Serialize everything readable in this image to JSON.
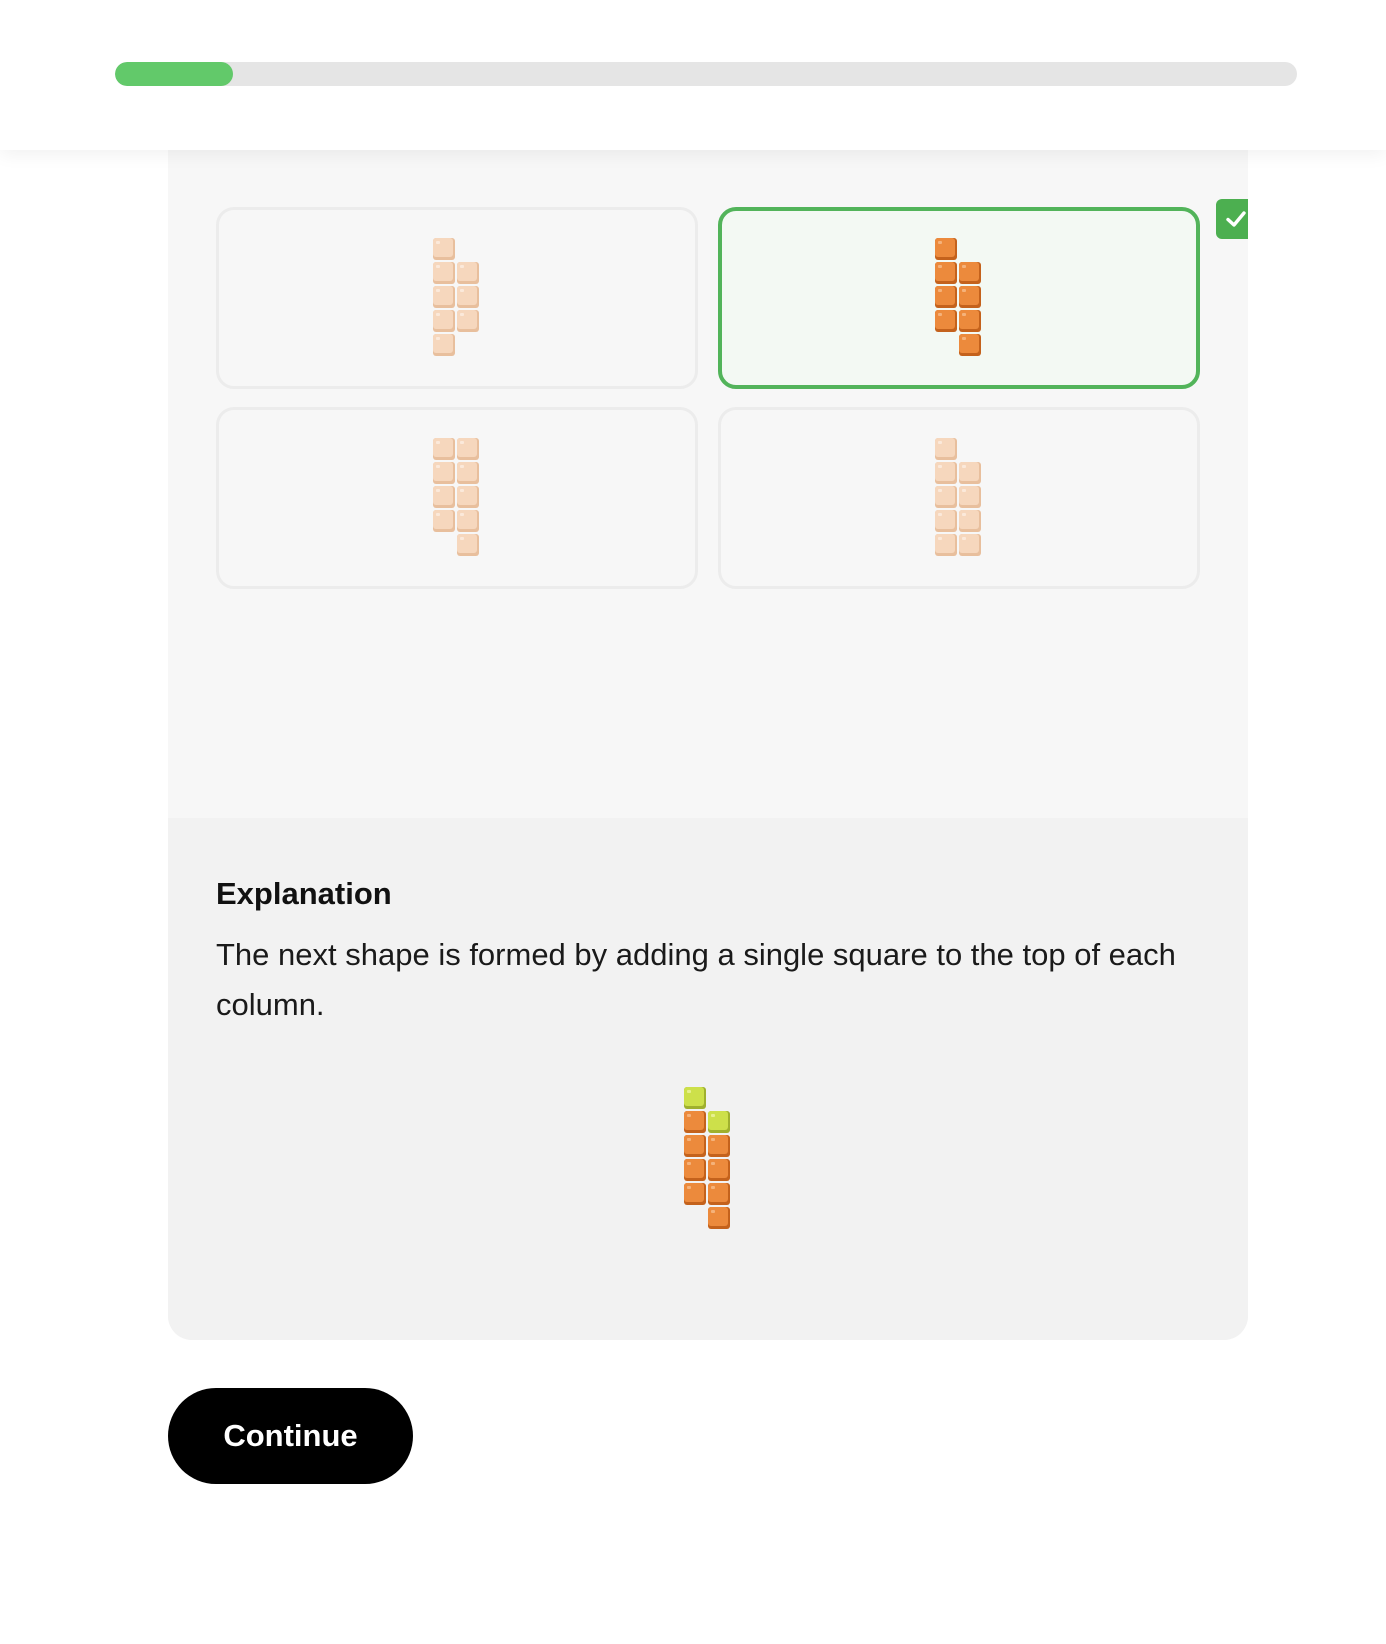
{
  "progress": {
    "value_fraction": 0.1,
    "color": "#62c96a"
  },
  "options": [
    {
      "id": "option-1",
      "selected": false,
      "palette": "light",
      "columns": [
        5,
        3
      ],
      "col_offsets": [
        0,
        1
      ]
    },
    {
      "id": "option-2",
      "selected": true,
      "palette": "orange",
      "columns": [
        4,
        4
      ],
      "col_offsets": [
        1,
        0
      ]
    },
    {
      "id": "option-3",
      "selected": false,
      "palette": "light",
      "columns": [
        4,
        5
      ],
      "col_offsets": [
        1,
        0
      ]
    },
    {
      "id": "option-4",
      "selected": false,
      "palette": "light",
      "columns": [
        5,
        4
      ],
      "col_offsets": [
        0,
        0
      ]
    }
  ],
  "selected_icon": "check-icon",
  "explanation": {
    "title": "Explanation",
    "text": "The next shape is formed by adding a single square to the top of each column.",
    "shape": {
      "palette": "orange",
      "columns": [
        4,
        4
      ],
      "col_offsets": [
        1,
        0
      ],
      "highlight_top": true,
      "highlight_color": "#cde04a"
    }
  },
  "continue_label": "Continue",
  "colors": {
    "light_block": "#f6d7bd",
    "orange_block": "#ec8a3c",
    "selected_border": "#52b45a",
    "check_badge": "#4caf50"
  }
}
